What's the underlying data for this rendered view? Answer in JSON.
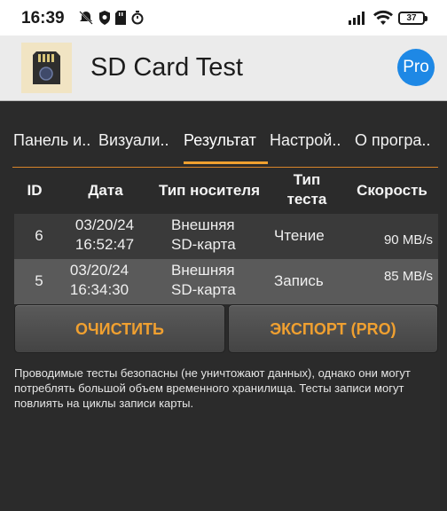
{
  "status_bar": {
    "time": "16:39",
    "battery": "37"
  },
  "app_bar": {
    "title": "SD Card Test",
    "pro_label": "Pro"
  },
  "tabs": [
    {
      "label": "Панель и.."
    },
    {
      "label": "Визуали.."
    },
    {
      "label": "Результат"
    },
    {
      "label": "Настрой.."
    },
    {
      "label": "О програ.."
    }
  ],
  "active_tab": "Результат",
  "table": {
    "headers": {
      "id": "ID",
      "date": "Дата",
      "media": "Тип носителя",
      "test_line1": "Тип",
      "test_line2": "теста",
      "speed": "Скорость"
    },
    "rows": [
      {
        "id": "6",
        "date": "03/20/24",
        "time": "16:52:47",
        "media_line1": "Внешняя",
        "media_line2": "SD-карта",
        "test": "Чтение",
        "speed": "90 MB/s"
      },
      {
        "id": "5",
        "date": "03/20/24",
        "time": "16:34:30",
        "media_line1": "Внешняя",
        "media_line2": "SD-карта",
        "test": "Запись",
        "speed": "85 MB/s"
      }
    ]
  },
  "buttons": {
    "clear": "ОЧИСТИТЬ",
    "export": "ЭКСПОРТ (PRO)"
  },
  "note": "Проводимые тесты безопасны (не уничтожают данных), однако они могут потреблять большой объем временного хранилища. Тесты записи могут повлиять на циклы записи карты.",
  "colors": {
    "accent": "#f0a030",
    "background": "#2b2b2b",
    "pro_badge": "#1e88e5"
  }
}
